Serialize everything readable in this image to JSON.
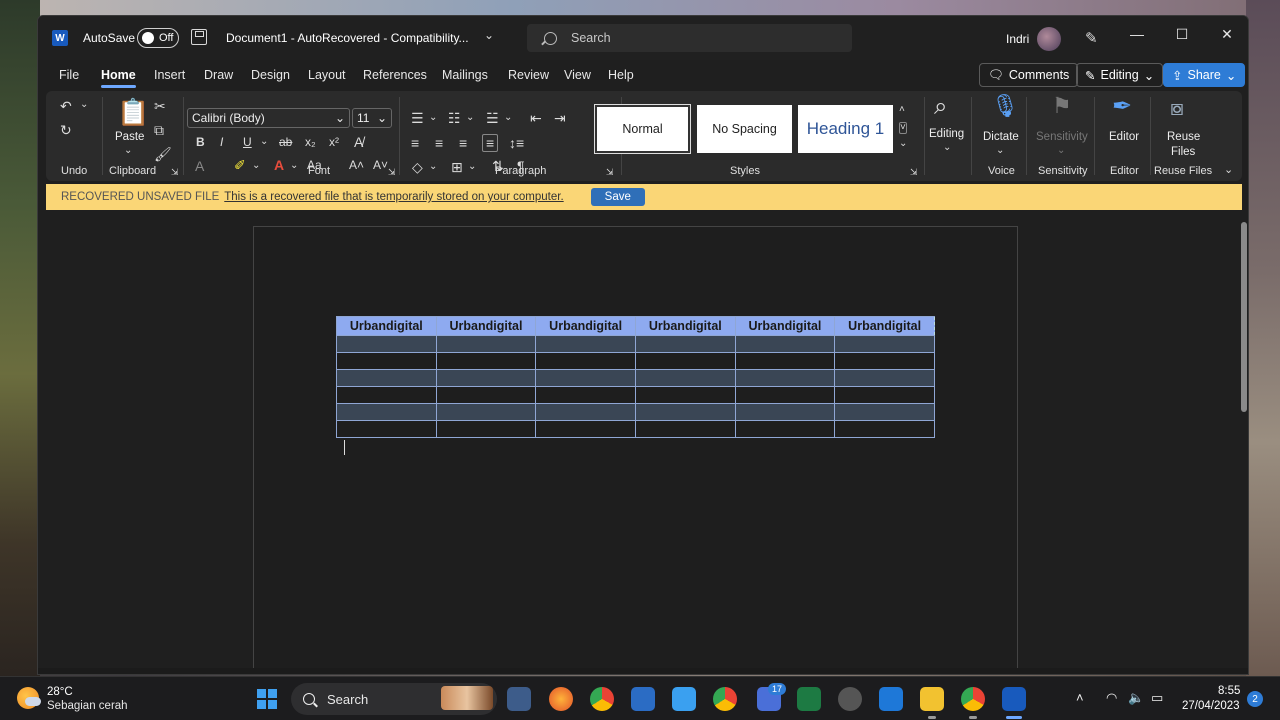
{
  "titlebar": {
    "autosave_label": "AutoSave",
    "autosave_state": "Off",
    "document_title": "Document1  -  AutoRecovered  -  Compatibility...",
    "search_placeholder": "Search",
    "user_name": "Indri"
  },
  "tabs": [
    "File",
    "Home",
    "Insert",
    "Draw",
    "Design",
    "Layout",
    "References",
    "Mailings",
    "Review",
    "View",
    "Help"
  ],
  "active_tab": "Home",
  "top_buttons": {
    "comments": "Comments",
    "editing": "Editing",
    "share": "Share"
  },
  "ribbon": {
    "groups": {
      "undo": "Undo",
      "clipboard": "Clipboard",
      "font": "Font",
      "paragraph": "Paragraph",
      "styles": "Styles",
      "voice": "Voice",
      "sensitivity": "Sensitivity",
      "editor": "Editor",
      "reuse_files": "Reuse Files"
    },
    "paste_label": "Paste",
    "font_name": "Calibri (Body)",
    "font_size": "11",
    "styles": [
      "Normal",
      "No Spacing",
      "Heading 1"
    ],
    "editing_label": "Editing",
    "dictate_label": "Dictate",
    "sensitivity_label": "Sensitivity",
    "editor_label": "Editor",
    "reuse_label_1": "Reuse",
    "reuse_label_2": "Files"
  },
  "recovered_bar": {
    "lead": "RECOVERED UNSAVED FILE",
    "message": "This is a recovered file that is temporarily stored on your computer.",
    "save_button": "Save"
  },
  "table": {
    "headers": [
      "Urbandigital",
      "Urbandigital",
      "Urbandigital",
      "Urbandigital",
      "Urbandigital",
      "Urbandigital"
    ],
    "empty_rows": 6
  },
  "taskbar": {
    "temperature": "28°C",
    "condition": "Sebagian cerah",
    "search_placeholder": "Search",
    "teams_badge": "17",
    "time": "8:55",
    "date": "27/04/2023",
    "notification_count": "2"
  },
  "colors": {
    "accent": "#2e7cd6",
    "recovered_bar": "#fad676",
    "table_header": "#8eaaf0",
    "table_band": "#3a4655"
  }
}
